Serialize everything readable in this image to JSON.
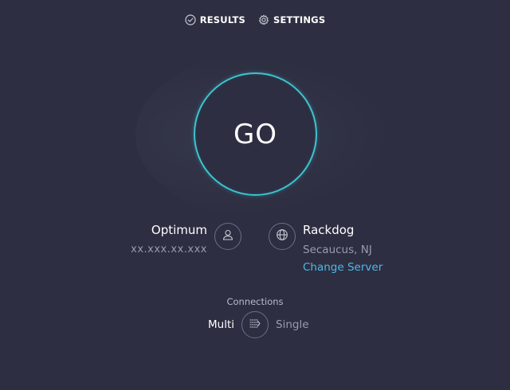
{
  "nav": {
    "results_label": "RESULTS",
    "settings_label": "SETTINGS"
  },
  "go_button": {
    "label": "GO"
  },
  "provider": {
    "name": "Optimum",
    "ip": "xx.xxx.xx.xxx"
  },
  "server": {
    "name": "Rackdog",
    "location": "Secaucus, NJ",
    "change_label": "Change Server"
  },
  "connections": {
    "label": "Connections",
    "multi_label": "Multi",
    "single_label": "Single",
    "selected": "Multi"
  },
  "colors": {
    "background": "#2d2e41",
    "accent_ring": "#3ec3d0",
    "link": "#4fb8e8",
    "muted_text": "#9a9bb0"
  },
  "icons": {
    "results": "check-circle-icon",
    "settings": "gear-icon",
    "provider": "user-icon",
    "server": "globe-icon",
    "connections": "multi-connection-arrows-icon"
  }
}
